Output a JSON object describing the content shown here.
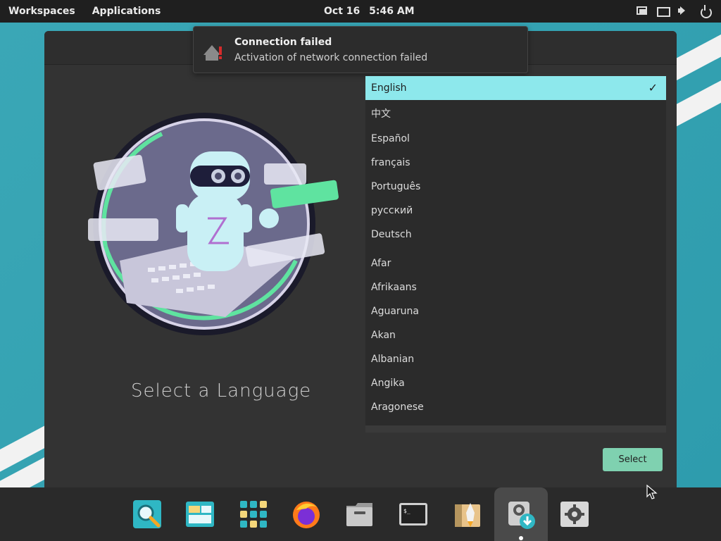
{
  "topbar": {
    "workspaces": "Workspaces",
    "applications": "Applications",
    "date": "Oct 16",
    "time": "5:46 AM"
  },
  "notification": {
    "title": "Connection failed",
    "body": "Activation of network connection failed"
  },
  "main": {
    "heading": "Select a Language",
    "select_label": "Select"
  },
  "languages": [
    {
      "label": "English",
      "selected": true
    },
    {
      "label": "中文"
    },
    {
      "label": "Español"
    },
    {
      "label": "français"
    },
    {
      "label": "Português"
    },
    {
      "label": "русский"
    },
    {
      "label": "Deutsch"
    },
    {
      "label": "Afar"
    },
    {
      "label": "Afrikaans"
    },
    {
      "label": "Aguaruna"
    },
    {
      "label": "Akan"
    },
    {
      "label": "Albanian"
    },
    {
      "label": "Angika"
    },
    {
      "label": "Aragonese"
    }
  ],
  "dock": {
    "items": [
      {
        "icon": "search-icon"
      },
      {
        "icon": "workspaces-icon"
      },
      {
        "icon": "app-grid-icon"
      },
      {
        "icon": "firefox-icon"
      },
      {
        "icon": "files-icon"
      },
      {
        "icon": "terminal-icon"
      },
      {
        "icon": "installer-rocket-icon"
      },
      {
        "icon": "distinst-installer-icon",
        "active": true
      },
      {
        "icon": "settings-gear-icon"
      }
    ]
  },
  "colors": {
    "accent": "#8de8ec",
    "select_button": "#7fd1b0",
    "error": "#d62b2b"
  }
}
